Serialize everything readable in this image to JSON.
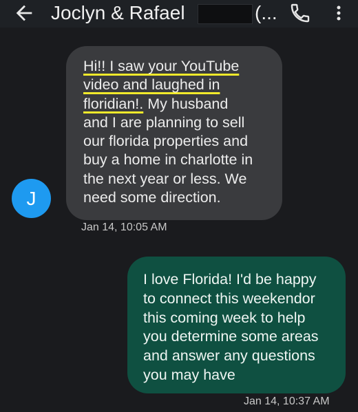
{
  "header": {
    "back_icon": "arrow-left-icon",
    "title": "Joclyn & Rafael",
    "title_suffix": "(...",
    "call_icon": "phone-icon",
    "more_icon": "more-vert-icon"
  },
  "colors": {
    "background": "#1a1b1e",
    "incoming_bubble": "#3a3b3e",
    "outgoing_bubble": "#0f5041",
    "avatar": "#1e9af0",
    "highlight": "#f2ea2b"
  },
  "messages": [
    {
      "direction": "incoming",
      "avatar_letter": "J",
      "highlighted_text": "Hi!! I saw your YouTube\nvideo and laughed in\nfloridian!.",
      "text": "  My husband\nand I are planning to sell\nour florida properties and\nbuy a home in charlotte in\nthe next year or less. We\nneed some direction.",
      "timestamp": "Jan 14, 10:05 AM"
    },
    {
      "direction": "outgoing",
      "text": "I love Florida! I'd be happy\nto connect this weekendor\nthis coming week to help\nyou determine some areas\nand answer any questions\nyou may have",
      "timestamp": "Jan 14, 10:37 AM"
    }
  ]
}
